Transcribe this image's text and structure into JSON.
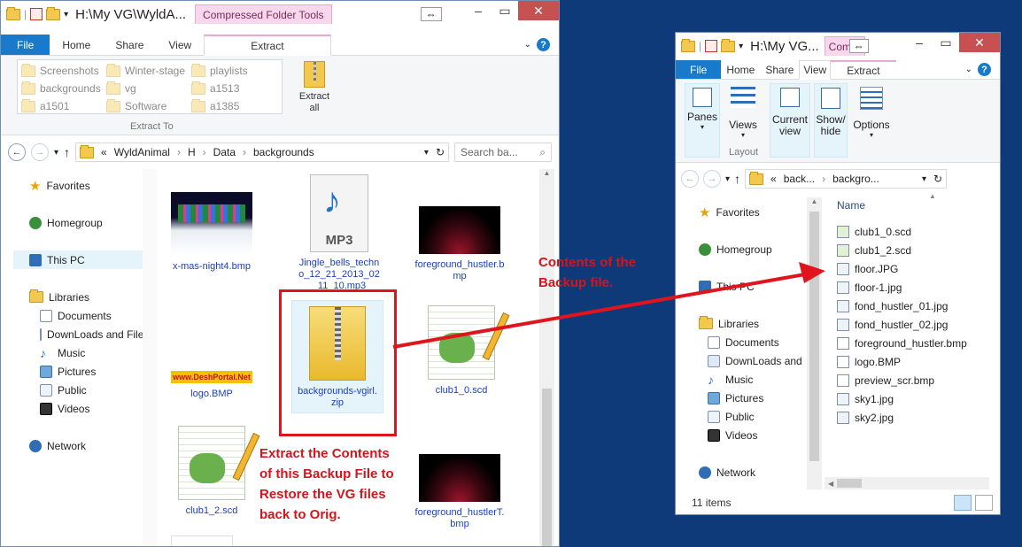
{
  "left": {
    "title": "H:\\My VG\\WyldA...",
    "context_tab": "Compressed Folder Tools",
    "tabs": [
      "File",
      "Home",
      "Share",
      "View",
      "Extract"
    ],
    "extract_to": {
      "destinations": [
        "Screenshots",
        "Winter-stage",
        "playlists",
        "backgrounds",
        "vg",
        "a1513",
        "a1501",
        "Software",
        "a1385"
      ],
      "group_label": "Extract To",
      "extract_all_label": "Extract all"
    },
    "breadcrumb": [
      "«",
      "WyldAnimal",
      "H",
      "Data",
      "backgrounds"
    ],
    "search_placeholder": "Search ba...",
    "nav": {
      "favorites": "Favorites",
      "homegroup": "Homegroup",
      "this_pc": "This PC",
      "libraries": "Libraries",
      "lib_items": [
        "Documents",
        "DownLoads and File",
        "Music",
        "Pictures",
        "Public",
        "Videos"
      ],
      "network": "Network"
    },
    "files": {
      "xmas": "x-mas-night4.bmp",
      "jingle": "Jingle_bells_techno_12_21_2013_02_11_10.mp3",
      "mp3_badge": "MP3",
      "fg_hustler": "foreground_hustler.bmp",
      "logo": "logo.BMP",
      "logo_image_text": "www.DeshPortal.Net",
      "zip": "backgrounds-vgirl.zip",
      "club1_0": "club1_0.scd",
      "club1_2": "club1_2.scd",
      "fg_hustlerT": "foreground_hustlerT.bmp"
    }
  },
  "right": {
    "title": "H:\\My VG...",
    "context_tab": "Compr",
    "tabs": [
      "File",
      "Home",
      "Share",
      "View",
      "Extract"
    ],
    "ribbon": {
      "panes": "Panes",
      "views": "Views",
      "current_view": "Current view",
      "show_hide": "Show/ hide",
      "options": "Options",
      "layout_group": "Layout"
    },
    "breadcrumb": [
      "«",
      "back...",
      "backgro..."
    ],
    "column_header": "Name",
    "nav": {
      "favorites": "Favorites",
      "homegroup": "Homegroup",
      "this_pc": "This PC",
      "libraries": "Libraries",
      "lib_items": [
        "Documents",
        "DownLoads and",
        "Music",
        "Pictures",
        "Public",
        "Videos"
      ],
      "network": "Network"
    },
    "files": [
      "club1_0.scd",
      "club1_2.scd",
      "floor.JPG",
      "floor-1.jpg",
      "fond_hustler_01.jpg",
      "fond_hustler_02.jpg",
      "foreground_hustler.bmp",
      "logo.BMP",
      "preview_scr.bmp",
      "sky1.jpg",
      "sky2.jpg"
    ],
    "status": "11 items"
  },
  "annotations": {
    "extract_note": [
      "Extract the Contents",
      "of this Backup File to",
      "Restore the VG files",
      "back to Orig."
    ],
    "contents_note": [
      "Contents of the",
      "Backup file."
    ]
  },
  "colors": {
    "annotation": "#e0141c",
    "file_tab": "#1979ca",
    "desktop": "#0e3a7a"
  }
}
